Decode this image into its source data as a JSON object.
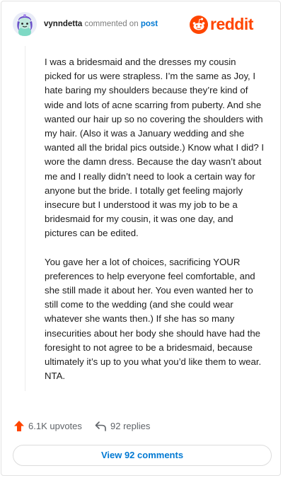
{
  "comment": {
    "username": "vynndetta",
    "action_text": "commented on",
    "post_link": "post",
    "paragraphs": [
      "I was a bridesmaid and the dresses my cousin picked for us were strapless. I’m the same as Joy, I hate baring my shoulders because they’re kind of wide and lots of acne scarring from puberty. And she wanted our hair up so no covering the shoulders with my hair. (Also it was a January wedding and she wanted all the bridal pics outside.) Know what I did? I wore the damn dress. Because the day wasn’t about me and I really didn’t need to look a certain way for anyone but the bride. I totally get feeling majorly insecure but I understood it was my job to be a bridesmaid for my cousin, it was one day, and pictures can be edited.",
      "You gave her a lot of choices, sacrificing YOUR preferences to help everyone feel comfortable, and she still made it about her. You even wanted her to still come to the wedding (and she could wear whatever she wants then.) If she has so many insecurities about her body she should have had the foresight to not agree to be a bridesmaid, because ultimately it’s up to you what you’d like them to wear. NTA."
    ]
  },
  "brand": {
    "logo_text": "reddit",
    "color": "#ff4500"
  },
  "actions": {
    "upvotes": "6.1K upvotes",
    "replies": "92 replies",
    "view_comments": "View 92 comments"
  },
  "icons": {
    "avatar": "snoo-avatar-icon",
    "logo": "reddit-logo-icon",
    "upvote": "upvote-arrow-icon",
    "reply": "reply-arrow-icon"
  }
}
